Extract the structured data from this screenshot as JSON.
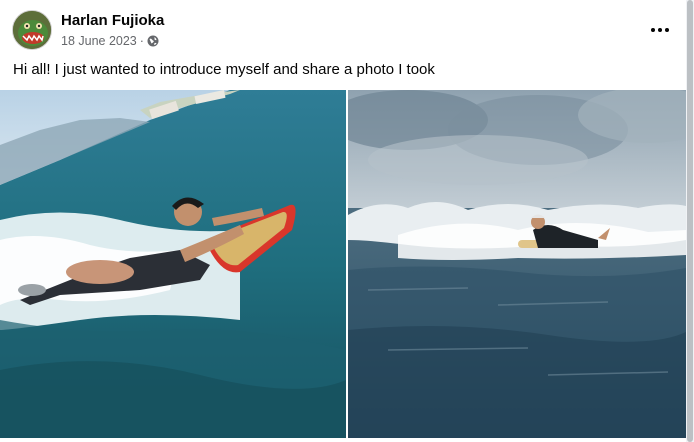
{
  "post": {
    "author": "Harlan Fujioka",
    "date": "18 June 2023",
    "separator": "·",
    "audience_icon": "globe-icon",
    "more_icon": "more-options-icon",
    "text": "Hi all! I just wanted to introduce myself and share a photo I took"
  },
  "photos": [
    {
      "name": "surfer-paddling-closeup-photo"
    },
    {
      "name": "surfer-paddling-wave-photo"
    }
  ],
  "colors": {
    "text_primary": "#050505",
    "text_secondary": "#65676b",
    "board_red": "#d9362b"
  }
}
